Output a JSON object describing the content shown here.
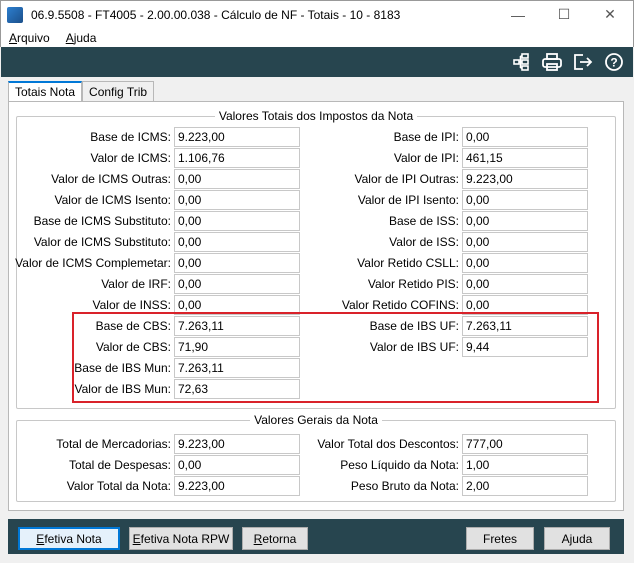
{
  "window": {
    "title": "06.9.5508 - FT4005 - 2.00.00.038 - Cálculo de NF - Totais - 10 - 8183",
    "minimize": "—",
    "maximize": "☐",
    "close": "✕"
  },
  "menu": [
    {
      "first": "A",
      "rest": "rquivo"
    },
    {
      "first": "A",
      "rest": "juda"
    }
  ],
  "toolbar": {
    "icons": [
      "tree-icon",
      "print-icon",
      "exit-icon",
      "help-icon"
    ],
    "help_glyph": "?"
  },
  "tabs": [
    {
      "label": "Totais Nota",
      "active": true
    },
    {
      "label": "Config Trib",
      "active": false
    }
  ],
  "taxes": {
    "title": "Valores Totais dos Impostos da Nota",
    "left": [
      {
        "label": "Base de ICMS:",
        "value": "9.223,00"
      },
      {
        "label": "Valor de ICMS:",
        "value": "1.106,76"
      },
      {
        "label": "Valor de ICMS Outras:",
        "value": "0,00"
      },
      {
        "label": "Valor de ICMS Isento:",
        "value": "0,00"
      },
      {
        "label": "Base de ICMS Substituto:",
        "value": "0,00"
      },
      {
        "label": "Valor de ICMS Substituto:",
        "value": "0,00"
      },
      {
        "label": "Valor de ICMS Complemetar:",
        "value": "0,00"
      },
      {
        "label": "Valor de IRF:",
        "value": "0,00"
      },
      {
        "label": "Valor de INSS:",
        "value": "0,00"
      },
      {
        "label": "Base de CBS:",
        "value": "7.263,11"
      },
      {
        "label": "Valor de CBS:",
        "value": "71,90"
      },
      {
        "label": "Base de IBS Mun:",
        "value": "7.263,11"
      },
      {
        "label": "Valor de IBS Mun:",
        "value": "72,63"
      }
    ],
    "right": [
      {
        "label": "Base de IPI:",
        "value": "0,00"
      },
      {
        "label": "Valor de IPI:",
        "value": "461,15"
      },
      {
        "label": "Valor de IPI Outras:",
        "value": "9.223,00"
      },
      {
        "label": "Valor de IPI Isento:",
        "value": "0,00"
      },
      {
        "label": "Base de ISS:",
        "value": "0,00"
      },
      {
        "label": "Valor de ISS:",
        "value": "0,00"
      },
      {
        "label": "Valor Retido CSLL:",
        "value": "0,00"
      },
      {
        "label": "Valor Retido PIS:",
        "value": "0,00"
      },
      {
        "label": "Valor Retido COFINS:",
        "value": "0,00"
      },
      {
        "label": "Base de IBS UF:",
        "value": "7.263,11"
      },
      {
        "label": "Valor de IBS UF:",
        "value": "9,44"
      }
    ]
  },
  "general": {
    "title": "Valores Gerais da Nota",
    "left": [
      {
        "label": "Total de Mercadorias:",
        "value": "9.223,00"
      },
      {
        "label": "Total de Despesas:",
        "value": "0,00"
      },
      {
        "label": "Valor Total da Nota:",
        "value": "9.223,00"
      }
    ],
    "right": [
      {
        "label": "Valor Total dos Descontos:",
        "value": "777,00"
      },
      {
        "label": "Peso Líquido da Nota:",
        "value": "1,00"
      },
      {
        "label": "Peso Bruto da Nota:",
        "value": "2,00"
      }
    ]
  },
  "buttons": [
    {
      "first": "E",
      "rest": "fetiva Nota"
    },
    {
      "first": "E",
      "rest": "fetiva Nota RPW"
    },
    {
      "first": "R",
      "rest": "etorna"
    },
    {
      "first": "",
      "rest": "Fretes"
    },
    {
      "first": "",
      "rest": "Ajuda"
    }
  ],
  "colors": {
    "toolbar_bg": "#27454f",
    "highlight_border": "#d9222a",
    "tab_accent": "#0078d7"
  }
}
